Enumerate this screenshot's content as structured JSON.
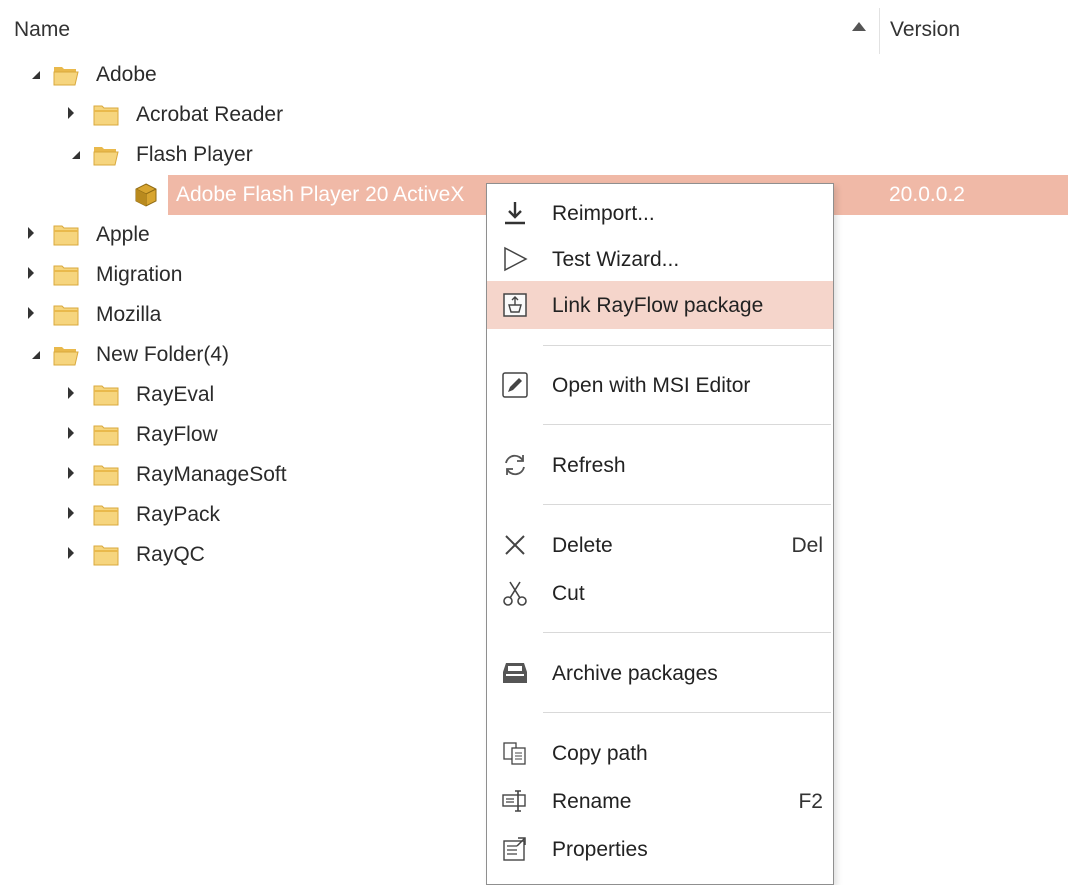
{
  "header": {
    "name_label": "Name",
    "version_label": "Version",
    "sort_icon": "sort-ascending-icon"
  },
  "tree": [
    {
      "label": "Adobe",
      "level": 0,
      "state": "open",
      "icon": "folder-open-icon"
    },
    {
      "label": "Acrobat Reader",
      "level": 1,
      "state": "closed",
      "icon": "folder-icon"
    },
    {
      "label": "Flash Player",
      "level": 1,
      "state": "open",
      "icon": "folder-open-icon"
    },
    {
      "label": "Adobe Flash Player 20 ActiveX",
      "level": 2,
      "state": "leaf",
      "icon": "package-icon",
      "selected": true,
      "version": "20.0.0.2"
    },
    {
      "label": "Apple",
      "level": 0,
      "state": "closed",
      "icon": "folder-icon"
    },
    {
      "label": "Migration",
      "level": 0,
      "state": "closed",
      "icon": "folder-icon"
    },
    {
      "label": "Mozilla",
      "level": 0,
      "state": "closed",
      "icon": "folder-icon"
    },
    {
      "label": "New Folder(4)",
      "level": 0,
      "state": "open",
      "icon": "folder-open-icon"
    },
    {
      "label": "RayEval",
      "level": 1,
      "state": "closed",
      "icon": "folder-icon"
    },
    {
      "label": "RayFlow",
      "level": 1,
      "state": "closed",
      "icon": "folder-icon"
    },
    {
      "label": "RayManageSoft",
      "level": 1,
      "state": "closed",
      "icon": "folder-icon"
    },
    {
      "label": "RayPack",
      "level": 1,
      "state": "closed",
      "icon": "folder-icon"
    },
    {
      "label": "RayQC",
      "level": 1,
      "state": "closed",
      "icon": "folder-icon"
    }
  ],
  "menu": {
    "items": [
      {
        "label": "Reimport...",
        "icon": "download-icon"
      },
      {
        "label": "Test Wizard...",
        "icon": "play-outline-icon"
      },
      {
        "label": "Link RayFlow package",
        "icon": "link-package-icon",
        "highlighted": true
      },
      {
        "label": "Open with MSI Editor",
        "icon": "edit-pencil-icon"
      },
      {
        "label": "Refresh",
        "icon": "refresh-icon"
      },
      {
        "label": "Delete",
        "icon": "delete-x-icon",
        "shortcut": "Del"
      },
      {
        "label": "Cut",
        "icon": "scissors-icon"
      },
      {
        "label": "Archive packages",
        "icon": "archive-icon"
      },
      {
        "label": "Copy path",
        "icon": "copy-icon"
      },
      {
        "label": "Rename",
        "icon": "rename-icon",
        "shortcut": "F2"
      },
      {
        "label": "Properties",
        "icon": "properties-icon"
      }
    ]
  },
  "colors": {
    "selection": "#f0b9a7",
    "menu_hover": "#f5d5cb",
    "folder": "#f3cc6b"
  }
}
